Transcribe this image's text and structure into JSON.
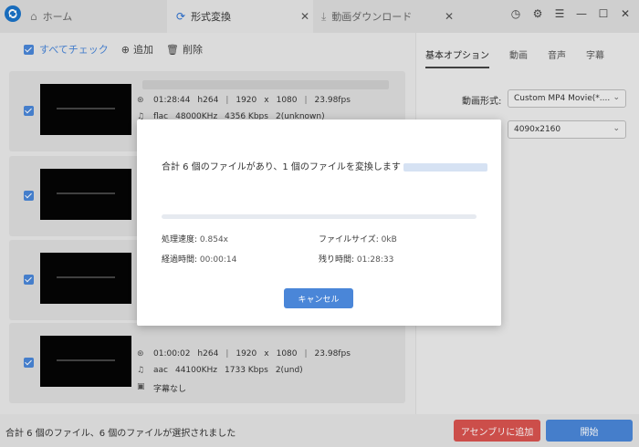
{
  "titlebar": {
    "tabs": [
      {
        "label": "ホーム",
        "icon": "home-icon"
      },
      {
        "label": "形式変換",
        "icon": "convert-icon"
      },
      {
        "label": "動画ダウンロード",
        "icon": "download-icon"
      }
    ],
    "close_glyph": "✕",
    "window_controls": [
      "clock-icon",
      "gear-icon",
      "menu-icon",
      "minimize-icon",
      "maximize-icon",
      "close-icon"
    ]
  },
  "toolbar": {
    "check_all_label": "すべてチェック",
    "add_label": "追加",
    "delete_label": "削除"
  },
  "files": [
    {
      "checked": true,
      "duration": "01:28:44",
      "vcodec": "h264",
      "width": "1920",
      "x": "x",
      "height": "1080",
      "fps": "23.98fps",
      "acodec": "flac",
      "samplerate": "48000KHz",
      "bitrate": "4356 Kbps",
      "channels": "2(unknown)"
    },
    {
      "checked": true
    },
    {
      "checked": true
    },
    {
      "checked": true,
      "duration": "01:00:02",
      "vcodec": "h264",
      "width": "1920",
      "x": "x",
      "height": "1080",
      "fps": "23.98fps",
      "acodec": "aac",
      "samplerate": "44100KHz",
      "bitrate": "1733 Kbps",
      "channels": "2(und)",
      "subtitle": "字幕なし"
    }
  ],
  "right_panel": {
    "tabs": [
      "基本オプション",
      "動画",
      "音声",
      "字幕"
    ],
    "format_label": "動画形式:",
    "format_value": "Custom MP4 Movie(*....",
    "resolution_value": "4090x2160"
  },
  "modal": {
    "message": "合計 6 個のファイルがあり、1 個のファイルを変換します",
    "progress": 0,
    "speed_label": "処理速度:",
    "speed_value": "0.854x",
    "size_label": "ファイルサイズ:",
    "size_value": "0kB",
    "elapsed_label": "経過時間:",
    "elapsed_value": "00:00:14",
    "remaining_label": "残り時間:",
    "remaining_value": "01:28:33",
    "cancel_label": "キャンセル"
  },
  "footer": {
    "status": "合計 6 個のファイル、6 個のファイルが選択されました",
    "add_to_assembly_label": "アセンブリに追加",
    "start_label": "開始"
  },
  "colors": {
    "accent": "#4a86d8",
    "danger": "#d9534f"
  }
}
